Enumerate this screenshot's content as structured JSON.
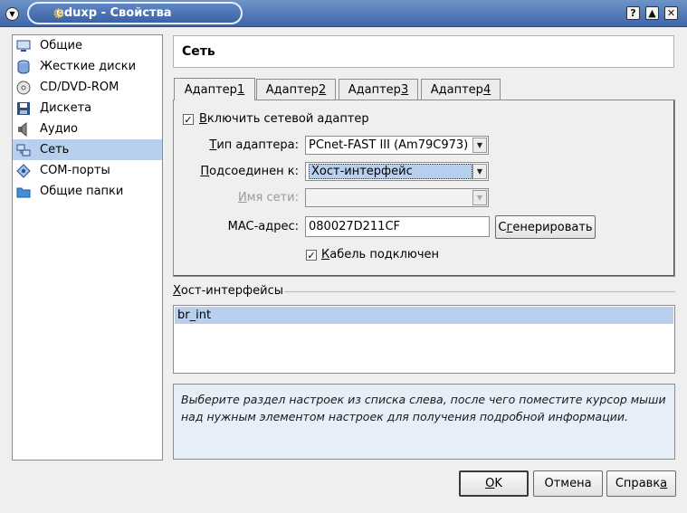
{
  "window": {
    "title": "eduxp - Свойства"
  },
  "sidebar": {
    "items": [
      {
        "label": "Общие",
        "icon": "monitor-icon"
      },
      {
        "label": "Жесткие диски",
        "icon": "hard-disk-icon"
      },
      {
        "label": "CD/DVD-ROM",
        "icon": "cd-icon"
      },
      {
        "label": "Дискета",
        "icon": "floppy-icon"
      },
      {
        "label": "Аудио",
        "icon": "speaker-icon"
      },
      {
        "label": "Сеть",
        "icon": "network-icon",
        "selected": true
      },
      {
        "label": "COM-порты",
        "icon": "serial-port-icon"
      },
      {
        "label": "Общие папки",
        "icon": "folder-icon"
      }
    ]
  },
  "page": {
    "title": "Сеть"
  },
  "tabs": [
    {
      "label": "Адаптер ",
      "num": "1",
      "active": true
    },
    {
      "label": "Адаптер ",
      "num": "2"
    },
    {
      "label": "Адаптер ",
      "num": "3"
    },
    {
      "label": "Адаптер ",
      "num": "4"
    }
  ],
  "adapter": {
    "enable_label_key": "В",
    "enable_label_rest": "ключить сетевой адаптер",
    "enable_checked": true,
    "type_label_key": "Т",
    "type_label_rest": "ип адаптера:",
    "type_value": "PCnet-FAST III (Am79C973)",
    "attached_label_key": "П",
    "attached_label_rest": "одсоединен к:",
    "attached_value": "Хост-интерфейс",
    "netname_label_key": "И",
    "netname_label_rest": "мя сети:",
    "netname_value": "",
    "mac_label": "MAC-адрес:",
    "mac_value": "080027D211CF",
    "generate_pre": "С",
    "generate_key": "г",
    "generate_rest": "енерировать",
    "cable_label_key": "К",
    "cable_label_rest": "абель подключен",
    "cable_checked": true
  },
  "host_interfaces": {
    "group_key": "Х",
    "group_rest": "ост-интерфейсы",
    "items": [
      "br_int"
    ]
  },
  "info_text": "Выберите раздел настроек из списка слева, после чего поместите курсор мыши над нужным элементом настроек для получения подробной информации.",
  "buttons": {
    "ok_key": "О",
    "ok_rest": "K",
    "cancel": "Отмена",
    "help_pre": "Справк",
    "help_key": "а"
  },
  "colors": {
    "titlebar": "#3e66a9",
    "selection": "#b8d0ee",
    "info_bg": "#e6eef8"
  }
}
